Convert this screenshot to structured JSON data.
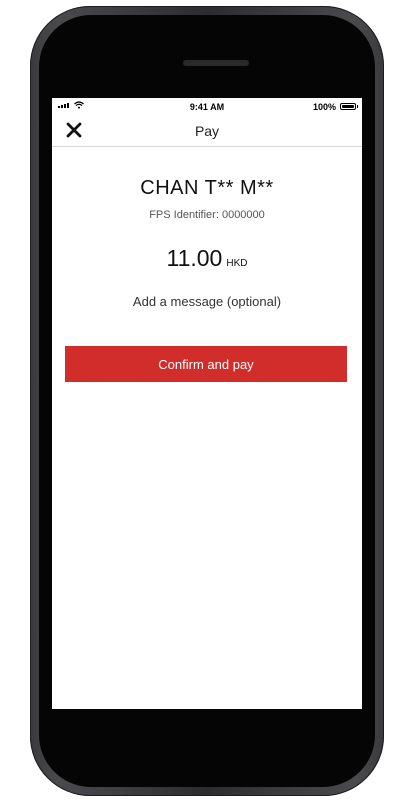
{
  "status_bar": {
    "time": "9:41 AM",
    "battery": "100%",
    "icons": [
      "signal-icon",
      "wifi-icon",
      "battery-icon"
    ]
  },
  "nav": {
    "title": "Pay",
    "close_icon": "close-icon"
  },
  "payee": {
    "name": "CHAN T** M**",
    "fps_identifier": "FPS Identifier: 0000000"
  },
  "payment": {
    "amount": "11.00",
    "currency": "HKD"
  },
  "message": {
    "label": "Add a message (optional)"
  },
  "actions": {
    "confirm_label": "Confirm and pay"
  },
  "colors": {
    "accent": "#d12d2a",
    "device": "#2c2c2e"
  }
}
